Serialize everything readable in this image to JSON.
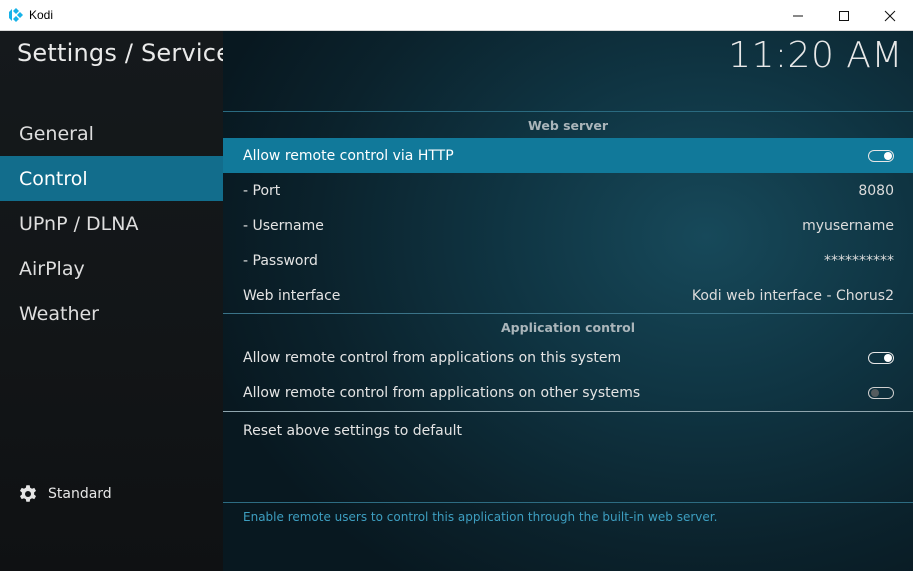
{
  "window": {
    "title": "Kodi",
    "icon": "kodi-logo-icon",
    "controls": [
      "minimize-icon",
      "maximize-icon",
      "close-icon"
    ]
  },
  "header": {
    "title": "Settings / Services",
    "clock": "11:20 AM"
  },
  "sidebar": {
    "items": [
      {
        "label": "General",
        "active": false
      },
      {
        "label": "Control",
        "active": true
      },
      {
        "label": "UPnP / DLNA",
        "active": false
      },
      {
        "label": "AirPlay",
        "active": false
      },
      {
        "label": "Weather",
        "active": false
      }
    ],
    "level": {
      "icon": "gear-icon",
      "label": "Standard"
    }
  },
  "settings": {
    "web_server": {
      "header": "Web server",
      "allow_http": {
        "label": "Allow remote control via HTTP",
        "enabled": true
      },
      "port": {
        "label": "- Port",
        "value": "8080"
      },
      "username": {
        "label": "- Username",
        "value": "myusername"
      },
      "password": {
        "label": "- Password",
        "value": "**********"
      },
      "web_interface": {
        "label": "Web interface",
        "value": "Kodi web interface - Chorus2"
      }
    },
    "app_control": {
      "header": "Application control",
      "this_system": {
        "label": "Allow remote control from applications on this system",
        "enabled": true
      },
      "other_systems": {
        "label": "Allow remote control from applications on other systems",
        "enabled": false
      }
    },
    "reset": {
      "label": "Reset above settings to default"
    }
  },
  "description": "Enable remote users to control this application through the built-in web server.",
  "colors": {
    "accent": "#126d8c",
    "focus": "#11799a",
    "description_text": "#3d9ec0"
  }
}
